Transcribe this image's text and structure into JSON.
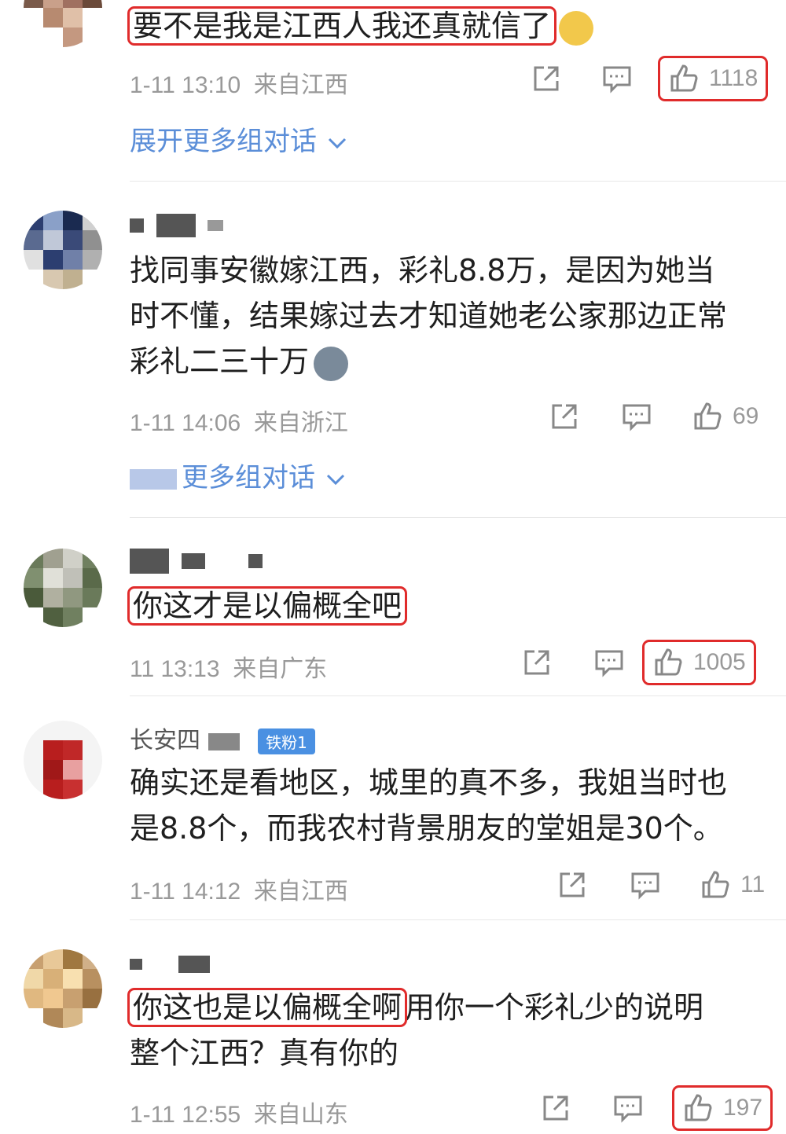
{
  "comments": [
    {
      "text": "要不是我是江西人我还真就信了",
      "time": "1-11 13:10",
      "location": "来自江西",
      "likes": "1118",
      "expand": "展开更多组对话"
    },
    {
      "text_lines": [
        "找同事安徽嫁江西，彩礼8.8万，是因为她当",
        "时不懂，结果嫁过去才知道她老公家那边正常",
        "彩礼二三十万"
      ],
      "time": "1-11 14:06",
      "location": "来自浙江",
      "likes": "69",
      "expand": "更多组对话"
    },
    {
      "text": "你这才是以偏概全吧",
      "time": "11 13:13",
      "location": "来自广东",
      "likes": "1005"
    },
    {
      "username": "长安四",
      "badge": "铁粉1",
      "text_lines": [
        "确实还是看地区，城里的真不多，我姐当时也",
        "是8.8个，而我农村背景朋友的堂姐是30个。"
      ],
      "time": "1-11 14:12",
      "location": "来自江西",
      "likes": "11"
    },
    {
      "text_highlight": "你这也是以偏概全啊",
      "text_rest": "用你一个彩礼少的说明",
      "text_line2": "整个江西？真有你的",
      "time": "1-11 12:55",
      "location": "来自山东",
      "likes": "197"
    }
  ],
  "icons": {
    "share": "share-icon",
    "reply": "comment-icon",
    "like": "thumbs-up-icon",
    "expand": "chevron-down-icon"
  },
  "colors": {
    "highlight": "#e02b2b",
    "link": "#5b8ed8",
    "meta": "#999999",
    "badge": "#4a90e2"
  }
}
